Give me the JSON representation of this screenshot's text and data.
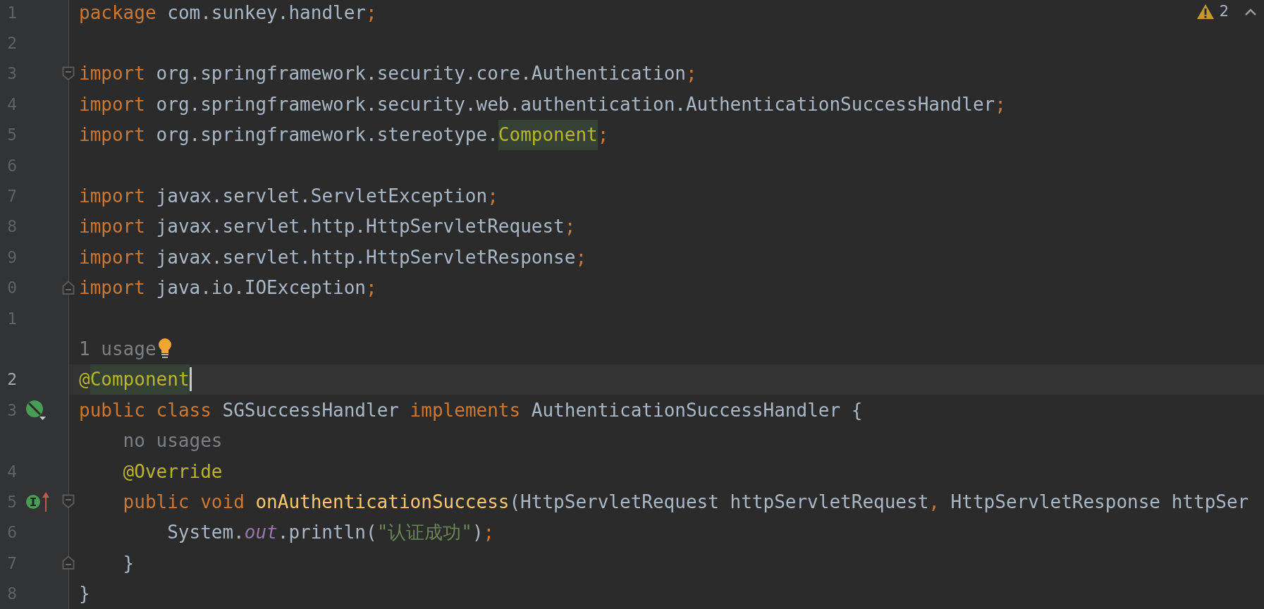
{
  "editor": {
    "warning_count": "2",
    "lines": [
      {
        "kind": "code",
        "number": "1",
        "current": false,
        "tokens": [
          {
            "text": "package ",
            "kind": "keyword",
            "highlighted": false
          },
          {
            "text": "com.sunkey.handler",
            "kind": "plain",
            "highlighted": false
          },
          {
            "text": ";",
            "kind": "punct",
            "highlighted": false
          }
        ]
      },
      {
        "kind": "code",
        "number": "2",
        "current": false
      },
      {
        "kind": "code",
        "number": "3",
        "current": false,
        "fold": {
          "kind": "start"
        },
        "tokens": [
          {
            "text": "import ",
            "kind": "keyword",
            "highlighted": false
          },
          {
            "text": "org.springframework.security.core.Authentication",
            "kind": "plain",
            "highlighted": false
          },
          {
            "text": ";",
            "kind": "punct",
            "highlighted": false
          }
        ]
      },
      {
        "kind": "code",
        "number": "4",
        "current": false,
        "tokens": [
          {
            "text": "import ",
            "kind": "keyword",
            "highlighted": false
          },
          {
            "text": "org.springframework.security.web.authentication.AuthenticationSuccessHandler",
            "kind": "plain",
            "highlighted": false
          },
          {
            "text": ";",
            "kind": "punct",
            "highlighted": false
          }
        ]
      },
      {
        "kind": "code",
        "number": "5",
        "current": false,
        "tokens": [
          {
            "text": "import ",
            "kind": "keyword",
            "highlighted": false
          },
          {
            "text": "org.springframework.stereotype.",
            "kind": "plain",
            "highlighted": false
          },
          {
            "text": "Component",
            "kind": "annotation",
            "highlighted": true
          },
          {
            "text": ";",
            "kind": "punct",
            "highlighted": false
          }
        ]
      },
      {
        "kind": "code",
        "number": "6",
        "current": false
      },
      {
        "kind": "code",
        "number": "7",
        "current": false,
        "tokens": [
          {
            "text": "import ",
            "kind": "keyword",
            "highlighted": false
          },
          {
            "text": "javax.servlet.ServletException",
            "kind": "plain",
            "highlighted": false
          },
          {
            "text": ";",
            "kind": "punct",
            "highlighted": false
          }
        ]
      },
      {
        "kind": "code",
        "number": "8",
        "current": false,
        "tokens": [
          {
            "text": "import ",
            "kind": "keyword",
            "highlighted": false
          },
          {
            "text": "javax.servlet.http.HttpServletRequest",
            "kind": "plain",
            "highlighted": false
          },
          {
            "text": ";",
            "kind": "punct",
            "highlighted": false
          }
        ]
      },
      {
        "kind": "code",
        "number": "9",
        "current": false,
        "tokens": [
          {
            "text": "import ",
            "kind": "keyword",
            "highlighted": false
          },
          {
            "text": "javax.servlet.http.HttpServletResponse",
            "kind": "plain",
            "highlighted": false
          },
          {
            "text": ";",
            "kind": "punct",
            "highlighted": false
          }
        ]
      },
      {
        "kind": "code",
        "number": "0",
        "current": false,
        "fold": {
          "kind": "end"
        },
        "tokens": [
          {
            "text": "import ",
            "kind": "keyword",
            "highlighted": false
          },
          {
            "text": "java.io.IOException",
            "kind": "plain",
            "highlighted": false
          },
          {
            "text": ";",
            "kind": "punct",
            "highlighted": false
          }
        ]
      },
      {
        "kind": "code",
        "number": "1",
        "current": false
      },
      {
        "kind": "inlay",
        "text": "1 usage",
        "bulb": true
      },
      {
        "kind": "code",
        "number": "2",
        "current": true,
        "caret": true,
        "tokens": [
          {
            "text": "@",
            "kind": "annotation",
            "highlighted": false
          },
          {
            "text": "Component",
            "kind": "annotation",
            "highlighted": true
          }
        ]
      },
      {
        "kind": "code",
        "number": "3",
        "current": false,
        "gutter_icon": {
          "kind": "bean"
        },
        "tokens": [
          {
            "text": "public class ",
            "kind": "keyword",
            "highlighted": false
          },
          {
            "text": "SGSuccessHandler ",
            "kind": "plain",
            "highlighted": false
          },
          {
            "text": "implements ",
            "kind": "keyword",
            "highlighted": false
          },
          {
            "text": "AuthenticationSuccessHandler {",
            "kind": "plain",
            "highlighted": false
          }
        ],
        "children": [
          {
            "kind": "inlay",
            "text": "no usages",
            "bulb": false
          },
          {
            "kind": "code",
            "number": "4",
            "current": false,
            "tokens": [
              {
                "text": "@Override",
                "kind": "annotation",
                "highlighted": false
              }
            ]
          },
          {
            "kind": "code",
            "number": "5",
            "current": false,
            "gutter_icon": {
              "kind": "implements"
            },
            "fold": {
              "kind": "start"
            },
            "tokens": [
              {
                "text": "public void ",
                "kind": "keyword",
                "highlighted": false
              },
              {
                "text": "onAuthenticationSuccess",
                "kind": "method",
                "highlighted": false
              },
              {
                "text": "(HttpServletRequest httpServletRequest",
                "kind": "plain",
                "highlighted": false
              },
              {
                "text": ", ",
                "kind": "punct",
                "highlighted": false
              },
              {
                "text": "HttpServletResponse httpSer",
                "kind": "plain",
                "highlighted": false
              }
            ],
            "children": [
              {
                "kind": "code",
                "number": "6",
                "current": false,
                "tokens": [
                  {
                    "text": "System.",
                    "kind": "plain",
                    "highlighted": false
                  },
                  {
                    "text": "out",
                    "kind": "static",
                    "highlighted": false
                  },
                  {
                    "text": ".println(",
                    "kind": "plain",
                    "highlighted": false
                  },
                  {
                    "text": "\"认证成功\"",
                    "kind": "string",
                    "highlighted": false
                  },
                  {
                    "text": ")",
                    "kind": "plain",
                    "highlighted": false
                  },
                  {
                    "text": ";",
                    "kind": "punct",
                    "highlighted": false
                  }
                ]
              }
            ]
          },
          {
            "kind": "code",
            "number": "7",
            "current": false,
            "fold": {
              "kind": "end"
            },
            "tokens": [
              {
                "text": "}",
                "kind": "plain",
                "highlighted": false
              }
            ]
          }
        ]
      },
      {
        "kind": "code",
        "number": "8",
        "current": false,
        "tokens": [
          {
            "text": "}",
            "kind": "plain",
            "highlighted": false
          }
        ]
      }
    ]
  }
}
